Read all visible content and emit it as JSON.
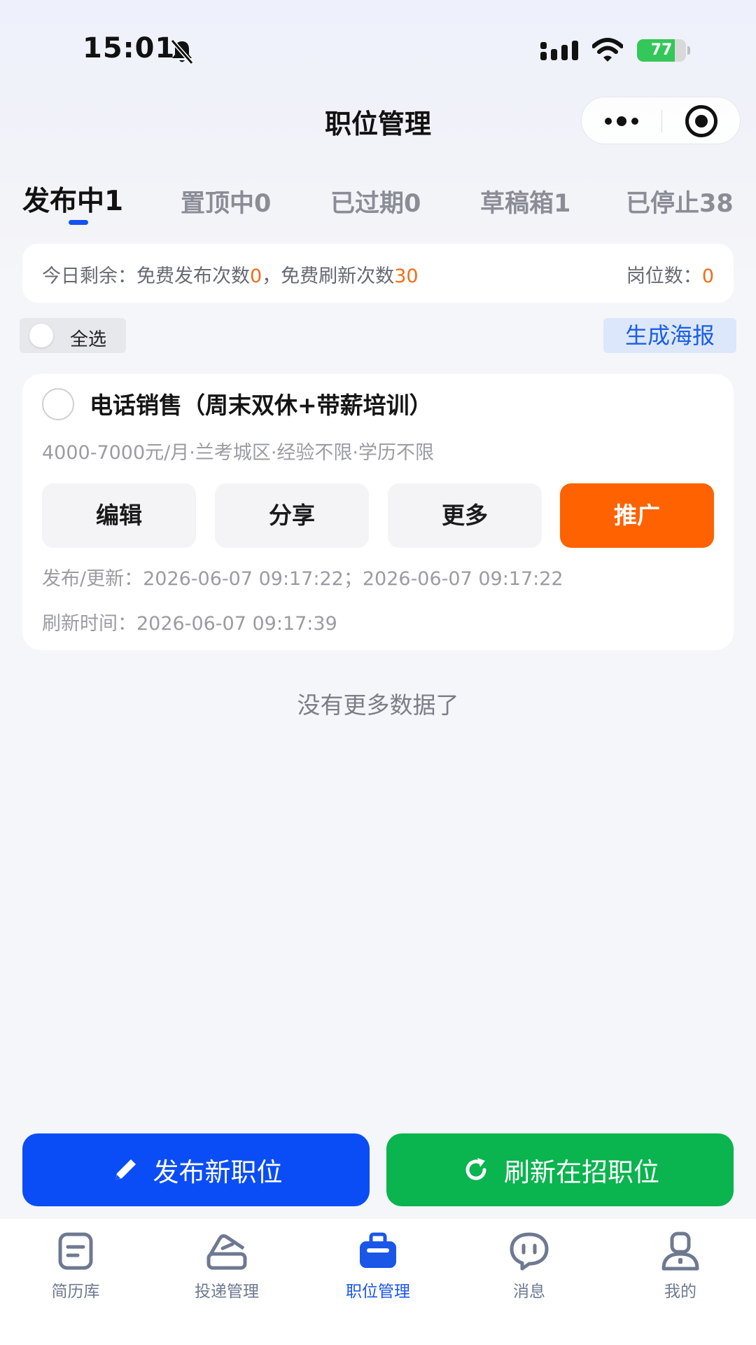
{
  "status_bar": {
    "time": "15:01",
    "battery_level": "77",
    "battery_fraction": 0.77
  },
  "nav": {
    "title": "职位管理"
  },
  "tabs": [
    {
      "label": "发布中1",
      "active": true
    },
    {
      "label": "置顶中0",
      "active": false
    },
    {
      "label": "已过期0",
      "active": false
    },
    {
      "label": "草稿箱1",
      "active": false
    },
    {
      "label": "已停止38",
      "active": false
    }
  ],
  "quota": {
    "prefix": "今日剩余：免费发布次数",
    "publish_count": "0",
    "middle": "，免费刷新次数",
    "refresh_count": "30",
    "positions_label": "岗位数：",
    "positions_count": "0"
  },
  "toolbar": {
    "select_all_label": "全选",
    "poster_label": "生成海报"
  },
  "job": {
    "title": "电话销售（周末双休+带薪培训）",
    "meta": "4000-7000元/月·兰考城区·经验不限·学历不限",
    "buttons": {
      "edit": "编辑",
      "share": "分享",
      "more": "更多",
      "promote": "推广"
    },
    "publish_update": "发布/更新：2026-06-07 09:17:22；2026-06-07 09:17:22",
    "refresh_time": "刷新时间：2026-06-07 09:17:39"
  },
  "no_more_text": "没有更多数据了",
  "actions": {
    "publish_label": "发布新职位",
    "refresh_label": "刷新在招职位"
  },
  "tabbar": [
    {
      "label": "简历库",
      "icon": "resume-icon",
      "active": false
    },
    {
      "label": "投递管理",
      "icon": "delivery-icon",
      "active": false
    },
    {
      "label": "职位管理",
      "icon": "briefcase-icon",
      "active": true
    },
    {
      "label": "消息",
      "icon": "message-icon",
      "active": false
    },
    {
      "label": "我的",
      "icon": "profile-icon",
      "active": false
    }
  ],
  "colors": {
    "accent_blue": "#0a4df7",
    "accent_green": "#0ab44e",
    "accent_orange": "#ff6200",
    "highlight_orange": "#f06e16"
  }
}
